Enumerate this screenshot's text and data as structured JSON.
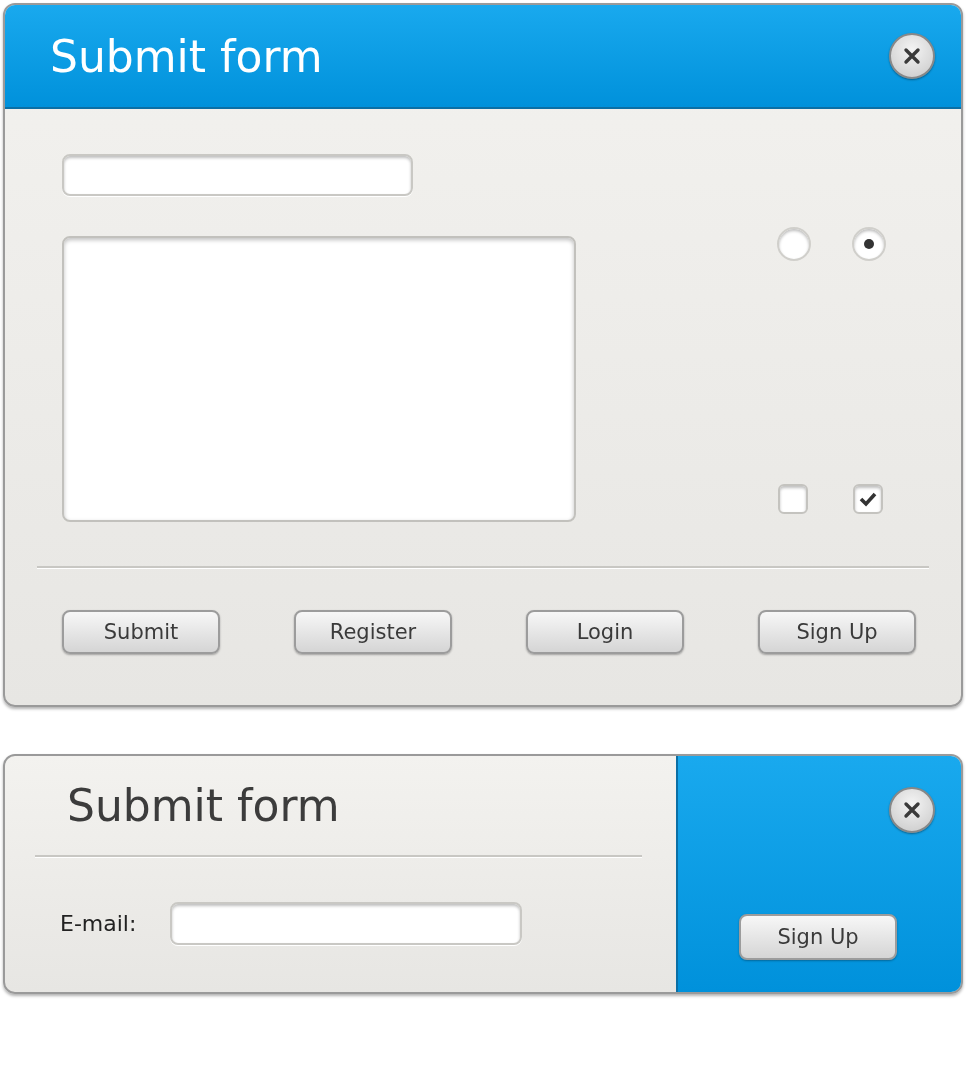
{
  "main_form": {
    "title": "Submit form",
    "radios": [
      {
        "selected": false
      },
      {
        "selected": true
      }
    ],
    "checkboxes": [
      {
        "checked": false
      },
      {
        "checked": true
      }
    ],
    "buttons": [
      "Submit",
      "Register",
      "Login",
      "Sign Up"
    ]
  },
  "signup_form": {
    "title": "Submit form",
    "email_label": "E-mail:",
    "button": "Sign Up"
  }
}
